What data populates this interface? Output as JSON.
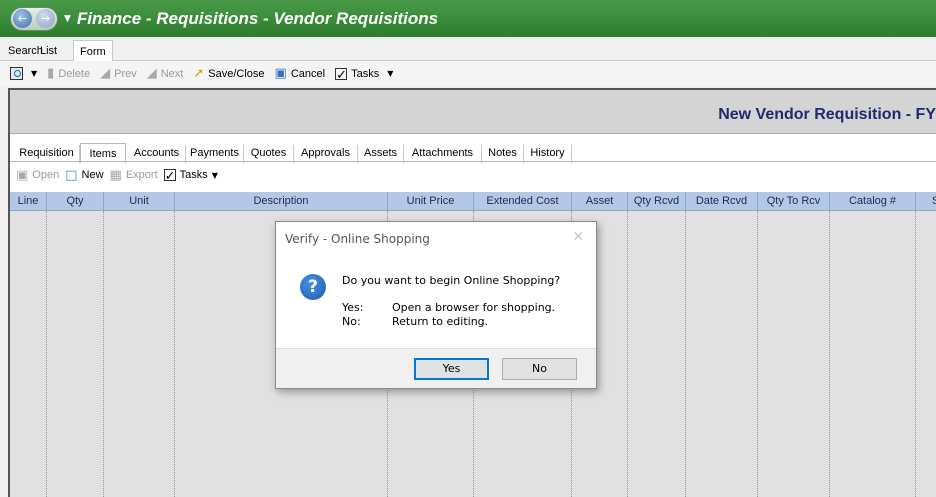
{
  "window": {
    "title": "Finance - Requisitions - Vendor Requisitions"
  },
  "top_tabs": [
    "Search",
    "List",
    "Form"
  ],
  "toolbar": {
    "delete": "Delete",
    "prev": "Prev",
    "next": "Next",
    "save_close": "Save/Close",
    "cancel": "Cancel",
    "tasks": "Tasks"
  },
  "form": {
    "banner_title": "New Vendor Requisition - FY"
  },
  "sub_tabs": [
    "Requisition",
    "Items",
    "Accounts",
    "Payments",
    "Quotes",
    "Approvals",
    "Assets",
    "Attachments",
    "Notes",
    "History"
  ],
  "sub_toolbar": {
    "open": "Open",
    "new": "New",
    "export": "Export",
    "tasks": "Tasks"
  },
  "grid": {
    "columns": [
      "Line",
      "Qty",
      "Unit",
      "Description",
      "Unit Price",
      "Extended Cost",
      "Asset",
      "Qty Rcvd",
      "Date Rcvd",
      "Qty To Rcv",
      "Catalog #",
      "S"
    ]
  },
  "dialog": {
    "title": "Verify - Online Shopping",
    "question": "Do you want to begin Online Shopping?",
    "yes_key": "Yes:",
    "yes_text": "Open a browser for shopping.",
    "no_key": "No:",
    "no_text": "Return to editing.",
    "yes_button": "Yes",
    "no_button": "No"
  },
  "icons": {
    "back": "back-arrow-icon",
    "forward": "forward-arrow-icon",
    "question": "question-icon"
  }
}
